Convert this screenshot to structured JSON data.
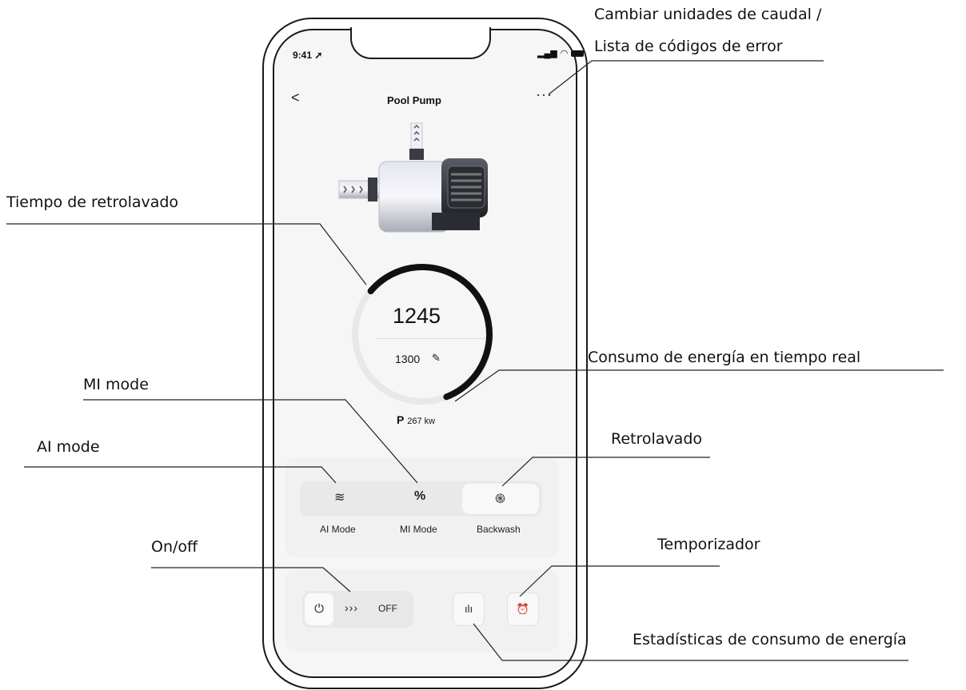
{
  "status_bar": {
    "time": "9:41",
    "icons": [
      "signal-icon",
      "wifi-icon",
      "battery-icon"
    ]
  },
  "header": {
    "back_label": "<",
    "title": "Pool Pump",
    "more_label": "···"
  },
  "gauge": {
    "current": "1245",
    "target": "1300",
    "progress": 0.58
  },
  "power": {
    "prefix": "P",
    "value": "267 kw"
  },
  "modes": [
    {
      "label": "AI Mode",
      "icon": "waves-icon",
      "glyph": "≋"
    },
    {
      "label": "MI Mode",
      "icon": "percent-icon",
      "glyph": "%"
    },
    {
      "label": "Backwash",
      "icon": "swirl-icon",
      "glyph": "֍"
    }
  ],
  "controls": {
    "switch_state": "OFF",
    "arrows": "›››",
    "power_glyph": "⏻",
    "stats_glyph": "ılı",
    "timer_glyph": "⏰"
  },
  "annotations": {
    "settings": "Cambiar unidades de caudal /",
    "settings_line2": "Lista de códigos de error",
    "backwash_time": "Tiempo de retrolavado",
    "energy_realtime": "Consumo de energía en tiempo real",
    "mi_mode": "MI mode",
    "ai_mode": "AI mode",
    "backwash": "Retrolavado",
    "on_off": "On/off",
    "timer": "Temporizador",
    "energy_stats": "Estadísticas de consumo de energía"
  },
  "colors": {
    "background": "#ffffff",
    "screen": "#f6f6f6",
    "ink": "#111111"
  }
}
